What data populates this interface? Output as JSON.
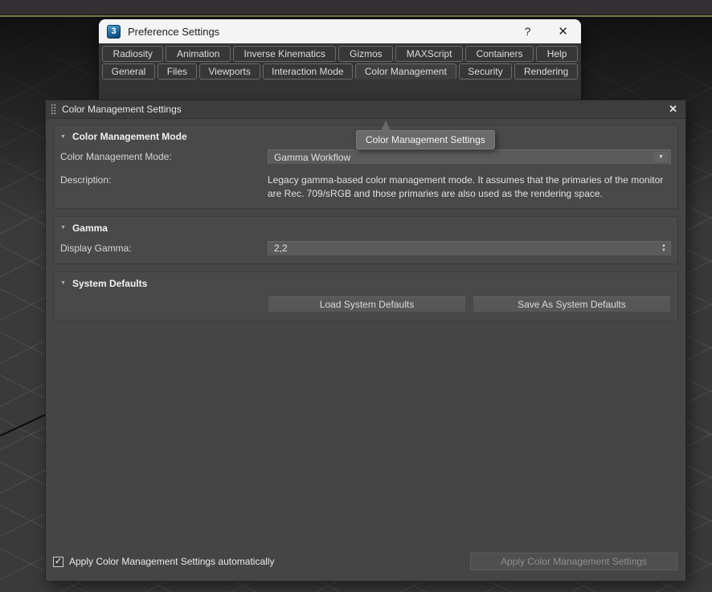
{
  "window": {
    "title": "Preference Settings"
  },
  "tabs": {
    "row1": [
      "Radiosity",
      "Animation",
      "Inverse Kinematics",
      "Gizmos",
      "MAXScript",
      "Containers",
      "Help"
    ],
    "row2": [
      "General",
      "Files",
      "Viewports",
      "Interaction Mode",
      "Color Management",
      "Security",
      "Rendering"
    ],
    "selected": "Color Management"
  },
  "panel": {
    "title": "Color Management Settings",
    "tooltip": "Color Management Settings",
    "mode_section": {
      "title": "Color Management Mode",
      "mode_label": "Color Management Mode:",
      "mode_value": "Gamma Workflow",
      "description_label": "Description:",
      "description": "Legacy gamma-based color management mode. It assumes that the primaries of the monitor are Rec. 709/sRGB and those primaries are also used as the rendering space."
    },
    "gamma_section": {
      "title": "Gamma",
      "gamma_label": "Display Gamma:",
      "gamma_value": "2,2"
    },
    "defaults_section": {
      "title": "System Defaults",
      "load_button": "Load System Defaults",
      "save_button": "Save As System Defaults"
    },
    "footer": {
      "checkbox_label": "Apply Color Management Settings automatically",
      "checkbox_checked": true,
      "apply_button": "Apply Color Management Settings"
    }
  },
  "icons": {
    "max_logo": "3",
    "help": "?",
    "close": "✕",
    "panel_close": "✕",
    "collapse": "▼",
    "dropdown": "▼",
    "spin_up": "▲",
    "spin_down": "▼",
    "check": "✓"
  },
  "colors": {
    "accent_olive": "#7e7b51",
    "titlebar_bg": "#f4f4f4",
    "panel_bg": "#454545",
    "viewport_bg": "#3a3a3a",
    "max_icon_blue": "#1c6a9c"
  }
}
